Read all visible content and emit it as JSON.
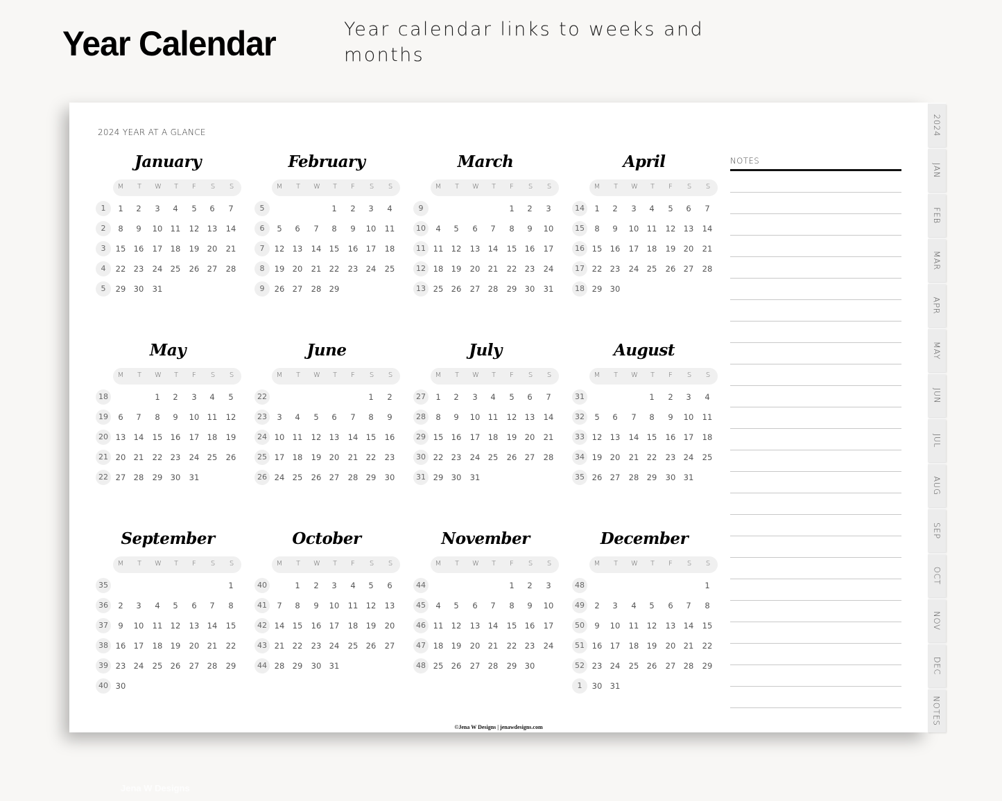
{
  "hero": {
    "title": "Year Calendar",
    "subtitle": "Year calendar links to weeks and months"
  },
  "page": {
    "heading": "2024 YEAR AT A GLANCE",
    "weekday_labels": [
      "M",
      "T",
      "W",
      "T",
      "F",
      "S",
      "S"
    ],
    "footer": "©Jena W Designs | jenawdesigns.com"
  },
  "months": [
    {
      "name": "January",
      "weeks": [
        {
          "wk": "1",
          "days": [
            "1",
            "2",
            "3",
            "4",
            "5",
            "6",
            "7"
          ]
        },
        {
          "wk": "2",
          "days": [
            "8",
            "9",
            "10",
            "11",
            "12",
            "13",
            "14"
          ]
        },
        {
          "wk": "3",
          "days": [
            "15",
            "16",
            "17",
            "18",
            "19",
            "20",
            "21"
          ]
        },
        {
          "wk": "4",
          "days": [
            "22",
            "23",
            "24",
            "25",
            "26",
            "27",
            "28"
          ]
        },
        {
          "wk": "5",
          "days": [
            "29",
            "30",
            "31",
            "",
            "",
            "",
            ""
          ]
        }
      ]
    },
    {
      "name": "February",
      "weeks": [
        {
          "wk": "5",
          "days": [
            "",
            "",
            "",
            "1",
            "2",
            "3",
            "4"
          ]
        },
        {
          "wk": "6",
          "days": [
            "5",
            "6",
            "7",
            "8",
            "9",
            "10",
            "11"
          ]
        },
        {
          "wk": "7",
          "days": [
            "12",
            "13",
            "14",
            "15",
            "16",
            "17",
            "18"
          ]
        },
        {
          "wk": "8",
          "days": [
            "19",
            "20",
            "21",
            "22",
            "23",
            "24",
            "25"
          ]
        },
        {
          "wk": "9",
          "days": [
            "26",
            "27",
            "28",
            "29",
            "",
            "",
            ""
          ]
        }
      ]
    },
    {
      "name": "March",
      "weeks": [
        {
          "wk": "9",
          "days": [
            "",
            "",
            "",
            "",
            "1",
            "2",
            "3"
          ]
        },
        {
          "wk": "10",
          "days": [
            "4",
            "5",
            "6",
            "7",
            "8",
            "9",
            "10"
          ]
        },
        {
          "wk": "11",
          "days": [
            "11",
            "12",
            "13",
            "14",
            "15",
            "16",
            "17"
          ]
        },
        {
          "wk": "12",
          "days": [
            "18",
            "19",
            "20",
            "21",
            "22",
            "23",
            "24"
          ]
        },
        {
          "wk": "13",
          "days": [
            "25",
            "26",
            "27",
            "28",
            "29",
            "30",
            "31"
          ]
        }
      ]
    },
    {
      "name": "April",
      "weeks": [
        {
          "wk": "14",
          "days": [
            "1",
            "2",
            "3",
            "4",
            "5",
            "6",
            "7"
          ]
        },
        {
          "wk": "15",
          "days": [
            "8",
            "9",
            "10",
            "11",
            "12",
            "13",
            "14"
          ]
        },
        {
          "wk": "16",
          "days": [
            "15",
            "16",
            "17",
            "18",
            "19",
            "20",
            "21"
          ]
        },
        {
          "wk": "17",
          "days": [
            "22",
            "23",
            "24",
            "25",
            "26",
            "27",
            "28"
          ]
        },
        {
          "wk": "18",
          "days": [
            "29",
            "30",
            "",
            "",
            "",
            "",
            ""
          ]
        }
      ]
    },
    {
      "name": "May",
      "weeks": [
        {
          "wk": "18",
          "days": [
            "",
            "",
            "1",
            "2",
            "3",
            "4",
            "5"
          ]
        },
        {
          "wk": "19",
          "days": [
            "6",
            "7",
            "8",
            "9",
            "10",
            "11",
            "12"
          ]
        },
        {
          "wk": "20",
          "days": [
            "13",
            "14",
            "15",
            "16",
            "17",
            "18",
            "19"
          ]
        },
        {
          "wk": "21",
          "days": [
            "20",
            "21",
            "22",
            "23",
            "24",
            "25",
            "26"
          ]
        },
        {
          "wk": "22",
          "days": [
            "27",
            "28",
            "29",
            "30",
            "31",
            "",
            ""
          ]
        }
      ]
    },
    {
      "name": "June",
      "weeks": [
        {
          "wk": "22",
          "days": [
            "",
            "",
            "",
            "",
            "",
            "1",
            "2"
          ]
        },
        {
          "wk": "23",
          "days": [
            "3",
            "4",
            "5",
            "6",
            "7",
            "8",
            "9"
          ]
        },
        {
          "wk": "24",
          "days": [
            "10",
            "11",
            "12",
            "13",
            "14",
            "15",
            "16"
          ]
        },
        {
          "wk": "25",
          "days": [
            "17",
            "18",
            "19",
            "20",
            "21",
            "22",
            "23"
          ]
        },
        {
          "wk": "26",
          "days": [
            "24",
            "25",
            "26",
            "27",
            "28",
            "29",
            "30"
          ]
        }
      ]
    },
    {
      "name": "July",
      "weeks": [
        {
          "wk": "27",
          "days": [
            "1",
            "2",
            "3",
            "4",
            "5",
            "6",
            "7"
          ]
        },
        {
          "wk": "28",
          "days": [
            "8",
            "9",
            "10",
            "11",
            "12",
            "13",
            "14"
          ]
        },
        {
          "wk": "29",
          "days": [
            "15",
            "16",
            "17",
            "18",
            "19",
            "20",
            "21"
          ]
        },
        {
          "wk": "30",
          "days": [
            "22",
            "23",
            "24",
            "25",
            "26",
            "27",
            "28"
          ]
        },
        {
          "wk": "31",
          "days": [
            "29",
            "30",
            "31",
            "",
            "",
            "",
            ""
          ]
        }
      ]
    },
    {
      "name": "August",
      "weeks": [
        {
          "wk": "31",
          "days": [
            "",
            "",
            "",
            "1",
            "2",
            "3",
            "4"
          ]
        },
        {
          "wk": "32",
          "days": [
            "5",
            "6",
            "7",
            "8",
            "9",
            "10",
            "11"
          ]
        },
        {
          "wk": "33",
          "days": [
            "12",
            "13",
            "14",
            "15",
            "16",
            "17",
            "18"
          ]
        },
        {
          "wk": "34",
          "days": [
            "19",
            "20",
            "21",
            "22",
            "23",
            "24",
            "25"
          ]
        },
        {
          "wk": "35",
          "days": [
            "26",
            "27",
            "28",
            "29",
            "30",
            "31",
            ""
          ]
        }
      ]
    },
    {
      "name": "September",
      "weeks": [
        {
          "wk": "35",
          "days": [
            "",
            "",
            "",
            "",
            "",
            "",
            "1"
          ]
        },
        {
          "wk": "36",
          "days": [
            "2",
            "3",
            "4",
            "5",
            "6",
            "7",
            "8"
          ]
        },
        {
          "wk": "37",
          "days": [
            "9",
            "10",
            "11",
            "12",
            "13",
            "14",
            "15"
          ]
        },
        {
          "wk": "38",
          "days": [
            "16",
            "17",
            "18",
            "19",
            "20",
            "21",
            "22"
          ]
        },
        {
          "wk": "39",
          "days": [
            "23",
            "24",
            "25",
            "26",
            "27",
            "28",
            "29"
          ]
        },
        {
          "wk": "40",
          "days": [
            "30",
            "",
            "",
            "",
            "",
            "",
            ""
          ]
        }
      ]
    },
    {
      "name": "October",
      "weeks": [
        {
          "wk": "40",
          "days": [
            "",
            "1",
            "2",
            "3",
            "4",
            "5",
            "6"
          ]
        },
        {
          "wk": "41",
          "days": [
            "7",
            "8",
            "9",
            "10",
            "11",
            "12",
            "13"
          ]
        },
        {
          "wk": "42",
          "days": [
            "14",
            "15",
            "16",
            "17",
            "18",
            "19",
            "20"
          ]
        },
        {
          "wk": "43",
          "days": [
            "21",
            "22",
            "23",
            "24",
            "25",
            "26",
            "27"
          ]
        },
        {
          "wk": "44",
          "days": [
            "28",
            "29",
            "30",
            "31",
            "",
            "",
            ""
          ]
        }
      ]
    },
    {
      "name": "November",
      "weeks": [
        {
          "wk": "44",
          "days": [
            "",
            "",
            "",
            "",
            "1",
            "2",
            "3"
          ]
        },
        {
          "wk": "45",
          "days": [
            "4",
            "5",
            "6",
            "7",
            "8",
            "9",
            "10"
          ]
        },
        {
          "wk": "46",
          "days": [
            "11",
            "12",
            "13",
            "14",
            "15",
            "16",
            "17"
          ]
        },
        {
          "wk": "47",
          "days": [
            "18",
            "19",
            "20",
            "21",
            "22",
            "23",
            "24"
          ]
        },
        {
          "wk": "48",
          "days": [
            "25",
            "26",
            "27",
            "28",
            "29",
            "30",
            ""
          ]
        }
      ]
    },
    {
      "name": "December",
      "weeks": [
        {
          "wk": "48",
          "days": [
            "",
            "",
            "",
            "",
            "",
            "",
            "1"
          ]
        },
        {
          "wk": "49",
          "days": [
            "2",
            "3",
            "4",
            "5",
            "6",
            "7",
            "8"
          ]
        },
        {
          "wk": "50",
          "days": [
            "9",
            "10",
            "11",
            "12",
            "13",
            "14",
            "15"
          ]
        },
        {
          "wk": "51",
          "days": [
            "16",
            "17",
            "18",
            "19",
            "20",
            "21",
            "22"
          ]
        },
        {
          "wk": "52",
          "days": [
            "23",
            "24",
            "25",
            "26",
            "27",
            "28",
            "29"
          ]
        },
        {
          "wk": "1",
          "days": [
            "30",
            "31",
            "",
            "",
            "",
            "",
            ""
          ]
        }
      ]
    }
  ],
  "notes": {
    "label": "NOTES",
    "line_count": 25
  },
  "tabs": [
    "2024",
    "JAN",
    "FEB",
    "MAR",
    "APR",
    "MAY",
    "JUN",
    "JUL",
    "AUG",
    "SEP",
    "OCT",
    "NOV",
    "DEC",
    "NOTES"
  ],
  "watermark": "Jena W Designs",
  "colors": {
    "background": "#f8f7f5",
    "page": "#ffffff",
    "pill": "#efefef",
    "text": "#555555",
    "tab": "#ececec"
  }
}
